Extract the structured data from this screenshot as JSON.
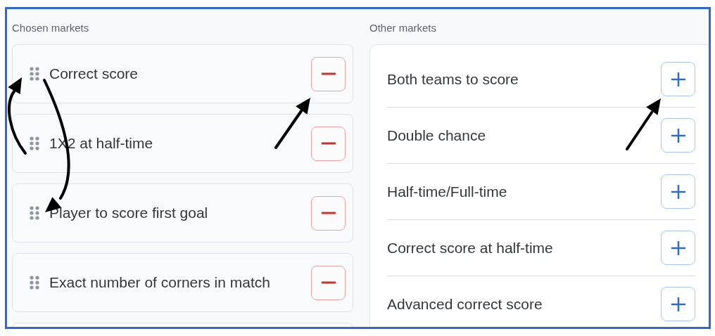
{
  "chosen_markets": {
    "heading": "Chosen markets",
    "items": [
      {
        "label": "Correct score"
      },
      {
        "label": "1X2 at half-time"
      },
      {
        "label": "Player to score first goal"
      },
      {
        "label": "Exact number of corners in match"
      }
    ]
  },
  "other_markets": {
    "heading": "Other markets",
    "items": [
      {
        "label": "Both teams to score"
      },
      {
        "label": "Double chance"
      },
      {
        "label": "Half-time/Full-time"
      },
      {
        "label": "Correct score at half-time"
      },
      {
        "label": "Advanced correct score"
      }
    ]
  }
}
